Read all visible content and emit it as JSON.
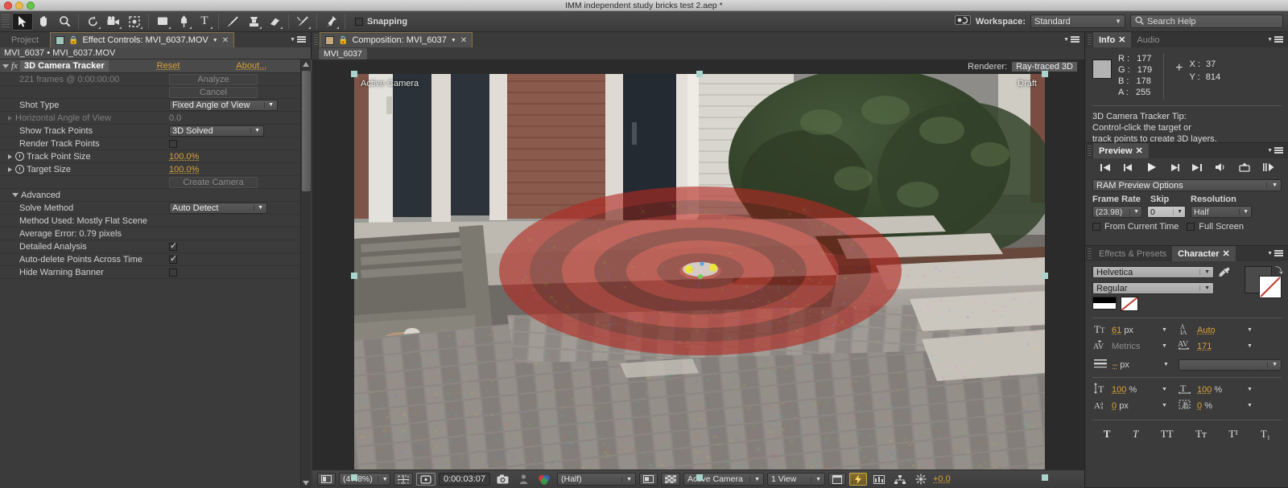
{
  "window": {
    "title": "IMM independent study bricks test 2.aep *"
  },
  "toolbar": {
    "tools": [
      {
        "name": "selection-tool",
        "glyph": "➤",
        "selected": true
      },
      {
        "name": "hand-tool",
        "glyph": "✋",
        "selected": false
      },
      {
        "name": "zoom-tool",
        "glyph": "🔍",
        "selected": false
      },
      {
        "name": "rotation-tool",
        "glyph": "↺",
        "selected": false
      },
      {
        "name": "camera-tool",
        "glyph": "🎥",
        "selected": false
      },
      {
        "name": "pan-behind-tool",
        "glyph": "✥",
        "selected": false
      },
      {
        "name": "shape-tool",
        "glyph": "▢",
        "selected": false
      },
      {
        "name": "pen-tool",
        "glyph": "✒",
        "selected": false
      },
      {
        "name": "text-tool",
        "glyph": "T",
        "selected": false
      },
      {
        "name": "brush-tool",
        "glyph": "✏",
        "selected": false
      },
      {
        "name": "clone-stamp-tool",
        "glyph": "⎙",
        "selected": false
      },
      {
        "name": "eraser-tool",
        "glyph": "▰",
        "selected": false
      },
      {
        "name": "roto-brush-tool",
        "glyph": "✎",
        "selected": false
      },
      {
        "name": "puppet-pin-tool",
        "glyph": "📌",
        "selected": false
      }
    ],
    "snapping_label": "Snapping",
    "snapping_checked": false,
    "workspace_label": "Workspace:",
    "workspace_value": "Standard",
    "search_placeholder": "Search Help"
  },
  "effect_controls": {
    "project_tab": "Project",
    "tab_title": "Effect Controls: MVI_6037.MOV",
    "header": "MVI_6037 • MVI_6037.MOV",
    "effect_name": "3D Camera Tracker",
    "reset_label": "Reset",
    "about_label": "About...",
    "frames_info": "221 frames @ 0:00:00:00",
    "analyze_label": "Analyze",
    "cancel_label": "Cancel",
    "shot_type_label": "Shot Type",
    "shot_type_value": "Fixed Angle of View",
    "hfov_label": "Horizontal Angle of View",
    "hfov_value": "0.0",
    "show_track_points_label": "Show Track Points",
    "show_track_points_value": "3D Solved",
    "render_track_points_label": "Render Track Points",
    "render_track_points_checked": false,
    "track_point_size_label": "Track Point Size",
    "track_point_size_value": "100.0%",
    "target_size_label": "Target Size",
    "target_size_value": "100.0%",
    "create_camera_label": "Create Camera",
    "advanced_label": "Advanced",
    "solve_method_label": "Solve Method",
    "solve_method_value": "Auto Detect",
    "method_used": "Method Used: Mostly Flat Scene",
    "average_error": "Average Error: 0.79 pixels",
    "detailed_analysis_label": "Detailed Analysis",
    "detailed_analysis_checked": true,
    "auto_delete_label": "Auto-delete Points Across Time",
    "auto_delete_checked": true,
    "hide_warning_label": "Hide Warning Banner",
    "hide_warning_checked": false
  },
  "composition": {
    "tab_title": "Composition: MVI_6037",
    "comp_name": "MVI_6037",
    "renderer_label": "Renderer:",
    "renderer_value": "Ray-traced 3D",
    "view_label": "Active Camera",
    "quality_label": "Draft",
    "bottom_bar": {
      "zoom": "(47.8%)",
      "time": "0:00:03:07",
      "resolution": "(Half)",
      "view_layout": "Active Camera",
      "views": "1 View",
      "exposure": "+0.0"
    }
  },
  "info_panel": {
    "tabs": [
      "Info",
      "Audio"
    ],
    "active_tab": "Info",
    "r_label": "R :",
    "r_value": "177",
    "g_label": "G :",
    "g_value": "179",
    "b_label": "B :",
    "b_value": "178",
    "a_label": "A :",
    "a_value": "255",
    "x_label": "X :",
    "x_value": "37",
    "y_label": "Y :",
    "y_value": "814",
    "swatch_color": "#b2b3b2",
    "tip_title": "3D Camera Tracker Tip:",
    "tip_line1": "Control-click the target or",
    "tip_line2": "track points to create 3D layers."
  },
  "preview_panel": {
    "tab": "Preview",
    "buttons": [
      "first-frame",
      "prev-frame",
      "play",
      "next-frame",
      "last-frame",
      "audio",
      "loop",
      "ram-preview"
    ],
    "ram_options": "RAM Preview Options",
    "frame_rate_label": "Frame Rate",
    "frame_rate_value": "(23.98)",
    "skip_label": "Skip",
    "skip_value": "0",
    "resolution_label": "Resolution",
    "resolution_value": "Half",
    "from_current_time_label": "From Current Time",
    "from_current_time_checked": false,
    "full_screen_label": "Full Screen",
    "full_screen_checked": false
  },
  "character_panel": {
    "tabs": [
      "Effects & Presets",
      "Character"
    ],
    "active_tab": "Character",
    "font_family": "Helvetica",
    "font_style": "Regular",
    "font_size": "61",
    "font_size_unit": "px",
    "leading": "Auto",
    "kerning": "Metrics",
    "tracking": "171",
    "stroke_width": "–",
    "stroke_width_unit": "px",
    "stroke_style": "",
    "vertical_scale": "100",
    "vertical_scale_unit": "%",
    "horizontal_scale": "100",
    "horizontal_scale_unit": "%",
    "baseline_shift": "0",
    "baseline_shift_unit": "px",
    "tsume": "0",
    "tsume_unit": "%",
    "style_buttons": [
      "T",
      "T",
      "TT",
      "Tᴛ",
      "T¹",
      "T₁"
    ]
  }
}
